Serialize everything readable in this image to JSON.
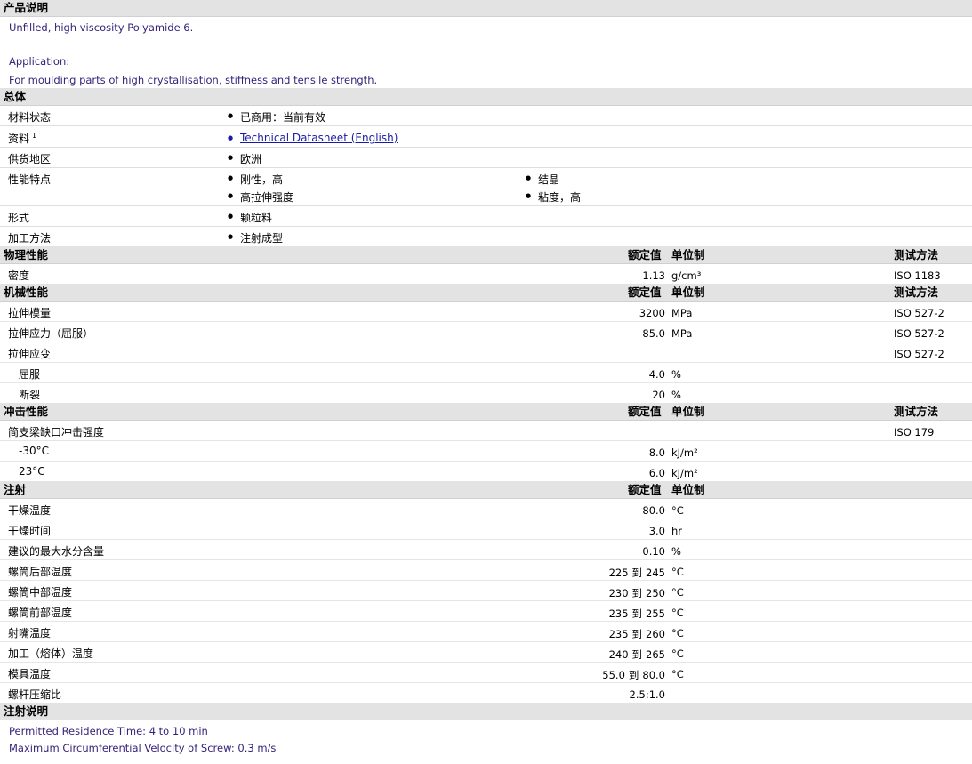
{
  "description": {
    "header": "产品说明",
    "line1": "Unfilled, high viscosity Polyamide 6.",
    "line2": "Application:",
    "line3": "For moulding parts of high crystallisation, stiffness and tensile strength."
  },
  "general": {
    "header": "总体",
    "material_status_label": "材料状态",
    "material_status": "已商用：当前有效",
    "docs_label": "资料",
    "docs_sup": "1",
    "docs_link": "Technical Datasheet (English)",
    "region_label": "供货地区",
    "region": "欧洲",
    "features_label": "性能特点",
    "features": [
      "刚性，高",
      "结晶",
      "高拉伸强度",
      "粘度，高"
    ],
    "form_label": "形式",
    "form": "颗粒料",
    "processing_label": "加工方法",
    "processing": "注射成型"
  },
  "col_headers": {
    "value": "额定值",
    "unit": "单位制",
    "method": "测试方法"
  },
  "physical": {
    "header": "物理性能",
    "rows": [
      {
        "label": "密度",
        "value": "1.13",
        "unit": "g/cm³",
        "method": "ISO 1183"
      }
    ]
  },
  "mechanical": {
    "header": "机械性能",
    "rows": [
      {
        "label": "拉伸模量",
        "value": "3200",
        "unit": "MPa",
        "method": "ISO 527-2"
      },
      {
        "label": "拉伸应力（屈服）",
        "value": "85.0",
        "unit": "MPa",
        "method": "ISO 527-2"
      },
      {
        "label": "拉伸应变",
        "value": "",
        "unit": "",
        "method": "ISO 527-2"
      },
      {
        "label": "屈服",
        "value": "4.0",
        "unit": "%",
        "method": ""
      },
      {
        "label": "断裂",
        "value": "20",
        "unit": "%",
        "method": ""
      }
    ]
  },
  "impact": {
    "header": "冲击性能",
    "rows": [
      {
        "label": "简支梁缺口冲击强度",
        "value": "",
        "unit": "",
        "method": "ISO 179"
      },
      {
        "label": "-30°C",
        "value": "8.0",
        "unit": "kJ/m²",
        "method": ""
      },
      {
        "label": "23°C",
        "value": "6.0",
        "unit": "kJ/m²",
        "method": ""
      }
    ]
  },
  "injection": {
    "header": "注射",
    "rows": [
      {
        "label": "干燥温度",
        "value": "80.0",
        "unit": "°C"
      },
      {
        "label": "干燥时间",
        "value": "3.0",
        "unit": "hr"
      },
      {
        "label": "建议的最大水分含量",
        "value": "0.10",
        "unit": "%"
      },
      {
        "label": "螺筒后部温度",
        "value_from": "225",
        "sep": "到",
        "value_to": "245",
        "unit": "°C"
      },
      {
        "label": "螺筒中部温度",
        "value_from": "230",
        "sep": "到",
        "value_to": "250",
        "unit": "°C"
      },
      {
        "label": "螺筒前部温度",
        "value_from": "235",
        "sep": "到",
        "value_to": "255",
        "unit": "°C"
      },
      {
        "label": "射嘴温度",
        "value_from": "235",
        "sep": "到",
        "value_to": "260",
        "unit": "°C"
      },
      {
        "label": "加工（熔体）温度",
        "value_from": "240",
        "sep": "到",
        "value_to": "265",
        "unit": "°C"
      },
      {
        "label": "模具温度",
        "value_from": "55.0",
        "sep": "到",
        "value_to": "80.0",
        "unit": "°C"
      },
      {
        "label": "螺杆压缩比",
        "value": "2.5:1.0",
        "unit": ""
      }
    ]
  },
  "injection_notes": {
    "header": "注射说明",
    "line1": "Permitted Residence Time: 4 to 10 min",
    "line2": "Maximum Circumferential Velocity of Screw: 0.3 m/s"
  }
}
